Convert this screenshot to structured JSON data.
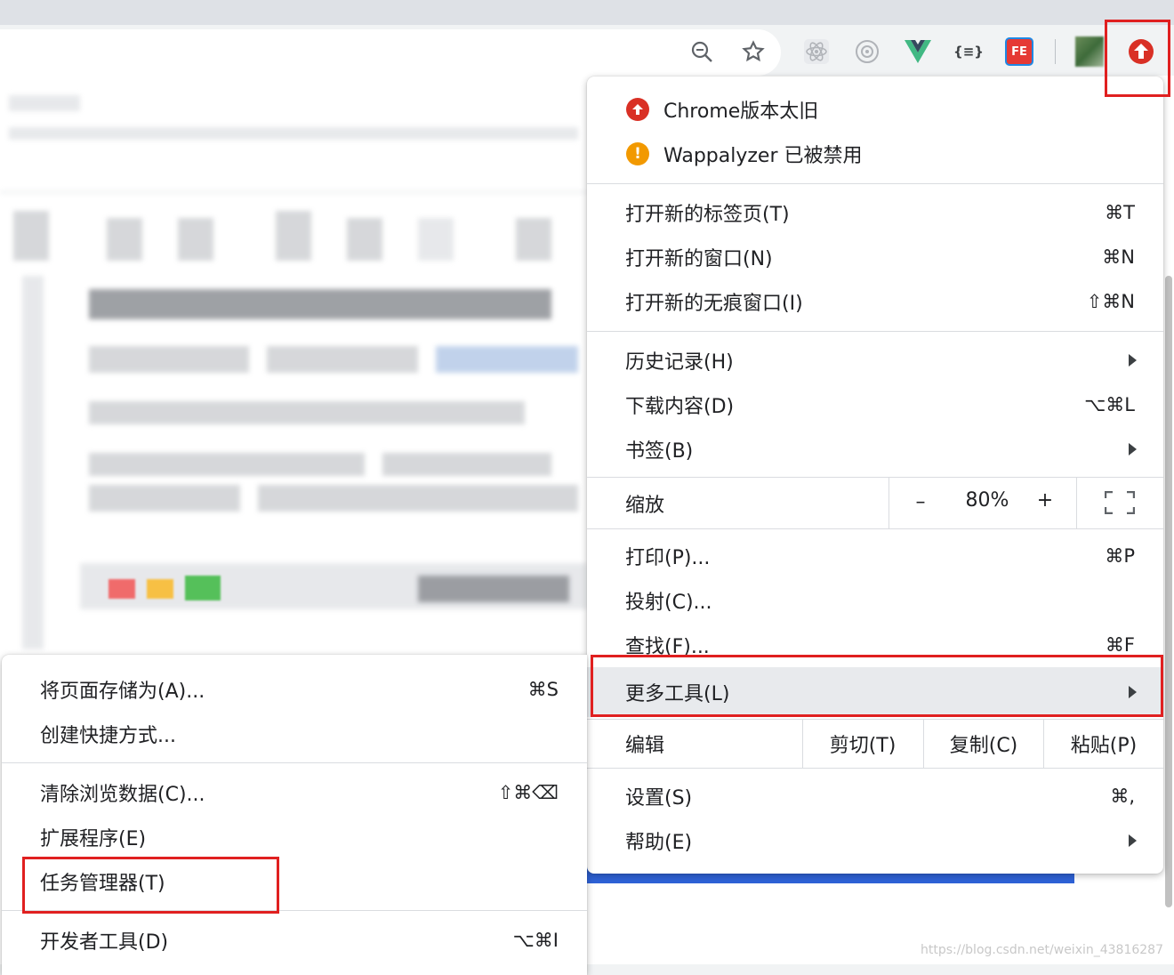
{
  "toolbar": {
    "icons": [
      "zoom-icon",
      "star-icon",
      "react-devtools-icon",
      "wappalyzer-icon",
      "vue-devtools-icon",
      "json-viewer-icon",
      "fehelper-icon",
      "profile-avatar",
      "update-icon"
    ],
    "json_viewer_label": "{≡}",
    "fehelper_label": "FE"
  },
  "notifications": [
    {
      "icon": "chrome-update-icon",
      "color": "#d93025",
      "glyph": "↑",
      "label": "Chrome版本太旧"
    },
    {
      "icon": "warning-icon",
      "color": "#f29900",
      "glyph": "!",
      "label": "Wappalyzer 已被禁用"
    }
  ],
  "main_menu": {
    "new_tab": {
      "label": "打开新的标签页(T)",
      "shortcut": "⌘T"
    },
    "new_window": {
      "label": "打开新的窗口(N)",
      "shortcut": "⌘N"
    },
    "new_incognito": {
      "label": "打开新的无痕窗口(I)",
      "shortcut": "⇧⌘N"
    },
    "history": {
      "label": "历史记录(H)"
    },
    "downloads": {
      "label": "下载内容(D)",
      "shortcut": "⌥⌘L"
    },
    "bookmarks": {
      "label": "书签(B)"
    },
    "zoom": {
      "label": "缩放",
      "minus": "–",
      "value": "80%",
      "plus": "+"
    },
    "print": {
      "label": "打印(P)...",
      "shortcut": "⌘P"
    },
    "cast": {
      "label": "投射(C)..."
    },
    "find": {
      "label": "查找(F)...",
      "shortcut": "⌘F"
    },
    "more_tools": {
      "label": "更多工具(L)"
    },
    "edit": {
      "label": "编辑",
      "cut": "剪切(T)",
      "copy": "复制(C)",
      "paste": "粘贴(P)"
    },
    "settings": {
      "label": "设置(S)",
      "shortcut": "⌘,"
    },
    "help": {
      "label": "帮助(E)"
    }
  },
  "submenu": {
    "save_page": {
      "label": "将页面存储为(A)...",
      "shortcut": "⌘S"
    },
    "create_shortcut": {
      "label": "创建快捷方式..."
    },
    "clear_data": {
      "label": "清除浏览数据(C)...",
      "shortcut": "⇧⌘⌫"
    },
    "extensions": {
      "label": "扩展程序(E)"
    },
    "task_manager": {
      "label": "任务管理器(T)"
    },
    "dev_tools": {
      "label": "开发者工具(D)",
      "shortcut": "⌥⌘I"
    }
  },
  "watermark": "https://blog.csdn.net/weixin_43816287",
  "colors": {
    "highlight_box": "#e02020",
    "update_red": "#d93025",
    "warning_orange": "#f29900",
    "hover_bg": "#e8eaed"
  }
}
